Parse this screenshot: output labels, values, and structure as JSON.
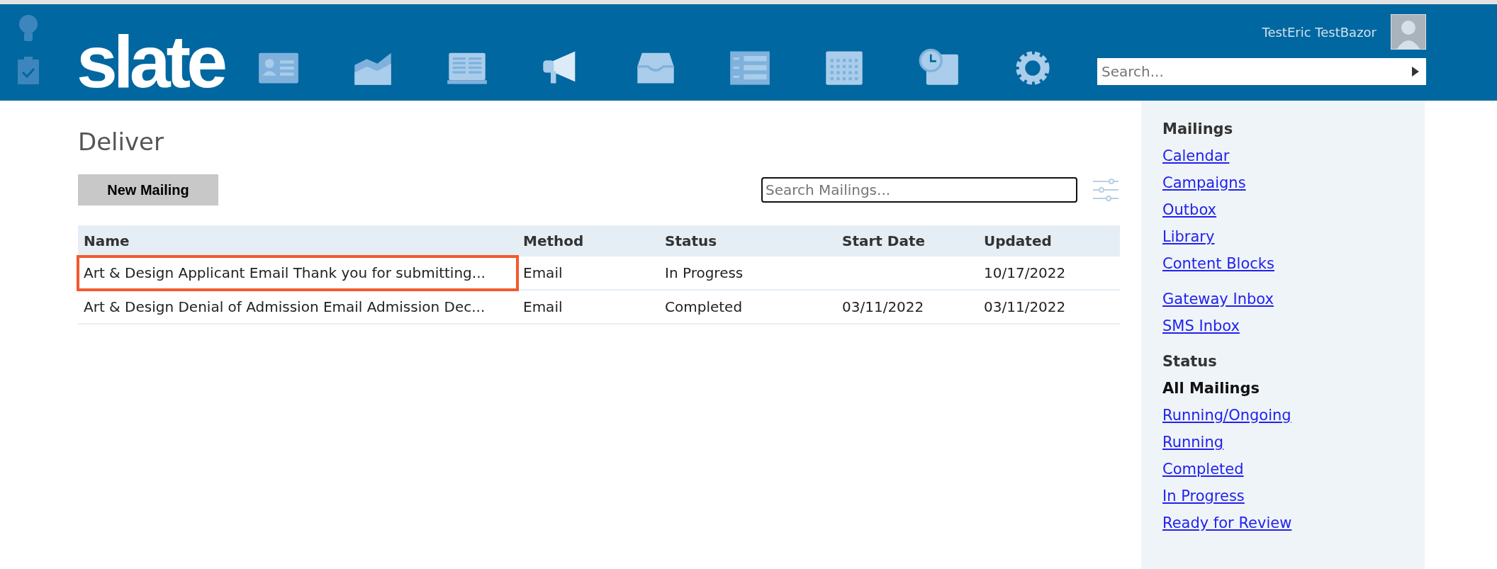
{
  "header": {
    "logo": "slate",
    "user_name": "TestEric TestBazor",
    "search": {
      "placeholder": "Search..."
    }
  },
  "page": {
    "title": "Deliver",
    "new_button": "New Mailing",
    "search": {
      "placeholder": "Search Mailings..."
    }
  },
  "table": {
    "columns": [
      "Name",
      "Method",
      "Status",
      "Start Date",
      "Updated"
    ],
    "rows": [
      {
        "cells": [
          "Art & Design Applicant Email Thank you for submitting...",
          "Email",
          "In Progress",
          "",
          "10/17/2022"
        ],
        "highlighted": true
      },
      {
        "cells": [
          "Art & Design Denial of Admission Email Admission Dec...",
          "Email",
          "Completed",
          "03/11/2022",
          "03/11/2022"
        ],
        "highlighted": false
      }
    ]
  },
  "sidebar": {
    "groups": [
      {
        "heading": "Mailings",
        "items": [
          {
            "label": "Calendar",
            "selected": false
          },
          {
            "label": "Campaigns",
            "selected": false
          },
          {
            "label": "Outbox",
            "selected": false
          },
          {
            "label": "Library",
            "selected": false
          },
          {
            "label": "Content Blocks",
            "selected": false
          }
        ]
      },
      {
        "items": [
          {
            "label": "Gateway Inbox",
            "selected": false
          },
          {
            "label": "SMS Inbox",
            "selected": false
          }
        ]
      },
      {
        "heading": "Status",
        "items": [
          {
            "label": "All Mailings",
            "selected": true
          },
          {
            "label": "Running/Ongoing",
            "selected": false
          },
          {
            "label": "Running",
            "selected": false
          },
          {
            "label": "Completed",
            "selected": false
          },
          {
            "label": "In Progress",
            "selected": false
          },
          {
            "label": "Ready for Review",
            "selected": false
          }
        ]
      }
    ]
  }
}
